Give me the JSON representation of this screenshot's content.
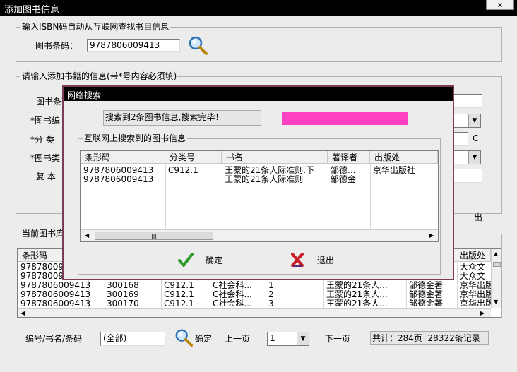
{
  "window": {
    "title": "添加图书信息",
    "close_label": "x"
  },
  "isbn_group": {
    "legend": "输入ISBN码自动从互联网查找书目信息",
    "label": "图书条码：",
    "value": "9787806009413"
  },
  "add_group": {
    "legend": "请输入添加书籍的信息(带*号内容必须填)",
    "field_labels": [
      "图书条码",
      "*图书编",
      "*分 类",
      "*图书类",
      "复 本"
    ],
    "c_label": "C",
    "out_label": "出"
  },
  "current_group": {
    "legend": "当前图书库",
    "columns": [
      "条形码",
      "出版处"
    ],
    "rows": [
      {
        "barcode": "978780094",
        "c2": "",
        "c3": "",
        "c4": "",
        "c5": "",
        "c6": "",
        "c7": "",
        "press": "大众文"
      },
      {
        "barcode": "978780094",
        "c2": "",
        "c3": "",
        "c4": "",
        "c5": "",
        "c6": "",
        "c7": "",
        "press": "大众文"
      },
      {
        "barcode": "9787806009413",
        "c2": "300168",
        "c3": "C912.1",
        "c4": "C社会科...",
        "c5": "1",
        "c6": "王蒙的21条人...",
        "c7": "邹德金著",
        "press": "京华出版"
      },
      {
        "barcode": "9787806009413",
        "c2": "300169",
        "c3": "C912.1",
        "c4": "C社会科...",
        "c5": "2",
        "c6": "王蒙的21条人...",
        "c7": "邹德金著",
        "press": "京华出版"
      },
      {
        "barcode": "9787806009413",
        "c2": "300170",
        "c3": "C912.1",
        "c4": "C社会科...",
        "c5": "3",
        "c6": "王蒙的21条人...",
        "c7": "邹德金著",
        "press": "京华出版"
      }
    ]
  },
  "footer": {
    "search_label": "编号/书名/条码",
    "search_value": "(全部)",
    "confirm_label": "确定",
    "prev_label": "上一页",
    "page_value": "1",
    "next_label": "下一页",
    "summary": "共计：284页  28322条记录"
  },
  "dialog": {
    "title": "网络搜索",
    "status": "搜索到2条图书信息,搜索完毕！",
    "progress_color": "#ff40c0",
    "group_legend": "互联网上搜索到的图书信息",
    "columns": [
      "条形码",
      "分类号",
      "书名",
      "著译者",
      "出版处"
    ],
    "rows": [
      {
        "barcode": "9787806009413",
        "class": "C912.1",
        "title": "王蒙的21条人际准则.下",
        "author": "邹德...",
        "press": "京华出版社"
      },
      {
        "barcode": "9787806009413",
        "class": "",
        "title": "王蒙的21条人际准则",
        "author": "邹德金",
        "press": ""
      }
    ],
    "ok_label": "确定",
    "exit_label": "退出"
  }
}
